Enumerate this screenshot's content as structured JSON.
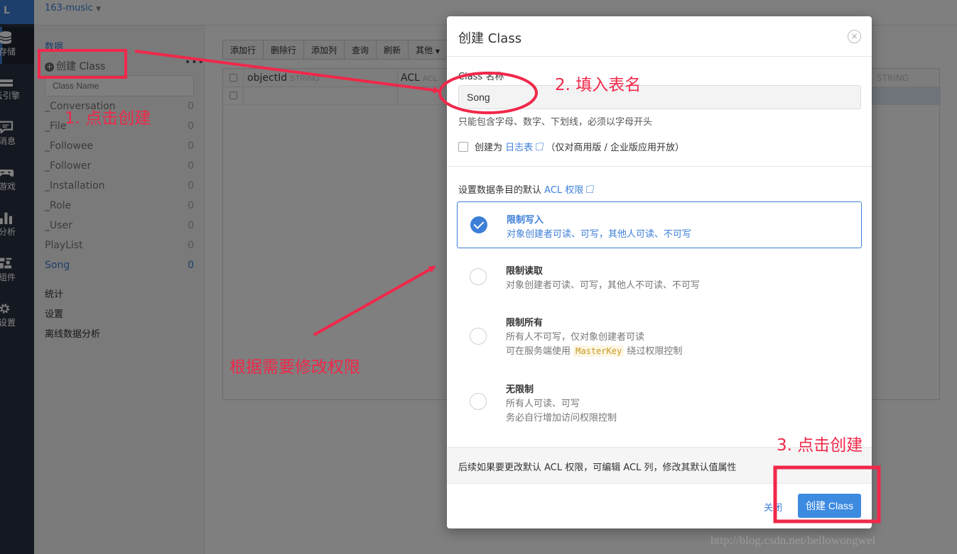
{
  "app": {
    "logo": "L",
    "name": "163-music"
  },
  "leftbar": {
    "items": [
      {
        "label": "存储",
        "icon": "database-icon"
      },
      {
        "label": "云引擎",
        "icon": "server-icon"
      },
      {
        "label": "消息",
        "icon": "chat-icon"
      },
      {
        "label": "游戏",
        "icon": "gamepad-icon"
      },
      {
        "label": "分析",
        "icon": "bar-chart-icon"
      },
      {
        "label": "组件",
        "icon": "widget-icon"
      },
      {
        "label": "设置",
        "icon": "gear-icon"
      }
    ]
  },
  "sidebar": {
    "section": "数据",
    "create_class": "创建 Class",
    "search_placeholder": "Class Name",
    "classes": [
      {
        "name": "_Conversation",
        "count": "0"
      },
      {
        "name": "_File",
        "count": "0"
      },
      {
        "name": "_Followee",
        "count": "0"
      },
      {
        "name": "_Follower",
        "count": "0"
      },
      {
        "name": "_Installation",
        "count": "0"
      },
      {
        "name": "_Role",
        "count": "0"
      },
      {
        "name": "_User",
        "count": "0"
      },
      {
        "name": "PlayList",
        "count": "0"
      },
      {
        "name": "Song",
        "count": "0"
      }
    ],
    "links": [
      "统计",
      "设置",
      "离线数据分析"
    ]
  },
  "toolbar": {
    "buttons": [
      "添加行",
      "删除行",
      "添加列",
      "查询",
      "刷新",
      "其他"
    ]
  },
  "grid": {
    "columns": [
      {
        "name": "objectId",
        "type": "STRING"
      },
      {
        "name": "ACL",
        "type": "ACL"
      }
    ],
    "right_type": "STRING"
  },
  "modal": {
    "title": "创建 Class",
    "close": "×",
    "name_label": "Class 名称",
    "name_value": "Song",
    "name_help": "只能包含字母、数字、下划线，必须以字母开头",
    "log_prefix": "创建为",
    "log_link": "日志表",
    "log_suffix": "（仅对商用版 / 企业版应用开放）",
    "acl_prefix": "设置数据条目的默认",
    "acl_link": "ACL 权限",
    "options": [
      {
        "title": "限制写入",
        "desc1": "对象创建者可读、可写，其他人可读、不可写",
        "selected": true
      },
      {
        "title": "限制读取",
        "desc1": "对象创建者可读、可写，其他人不可读、不可写",
        "selected": false
      },
      {
        "title": "限制所有",
        "desc1": "所有人不可写，仅对象创建者可读",
        "desc2_prefix": "可在服务端使用",
        "desc2_code": "MasterKey",
        "desc2_suffix": "绕过权限控制",
        "selected": false
      },
      {
        "title": "无限制",
        "desc1": "所有人可读、可写",
        "desc2": "务必自行增加访问权限控制",
        "selected": false
      }
    ],
    "note": "后续如果要更改默认 ACL 权限，可编辑 ACL 列，修改其默认值属性",
    "cancel": "关闭",
    "submit": "创建 Class"
  },
  "annotations": {
    "step1": "1. 点击创建",
    "step2": "2. 填入表名",
    "step3": "3. 点击创建",
    "acl_hint": "根据需要修改权限",
    "watermark": "http://blog.csdn.net/hellowongwei",
    "color": "#f0284a"
  }
}
